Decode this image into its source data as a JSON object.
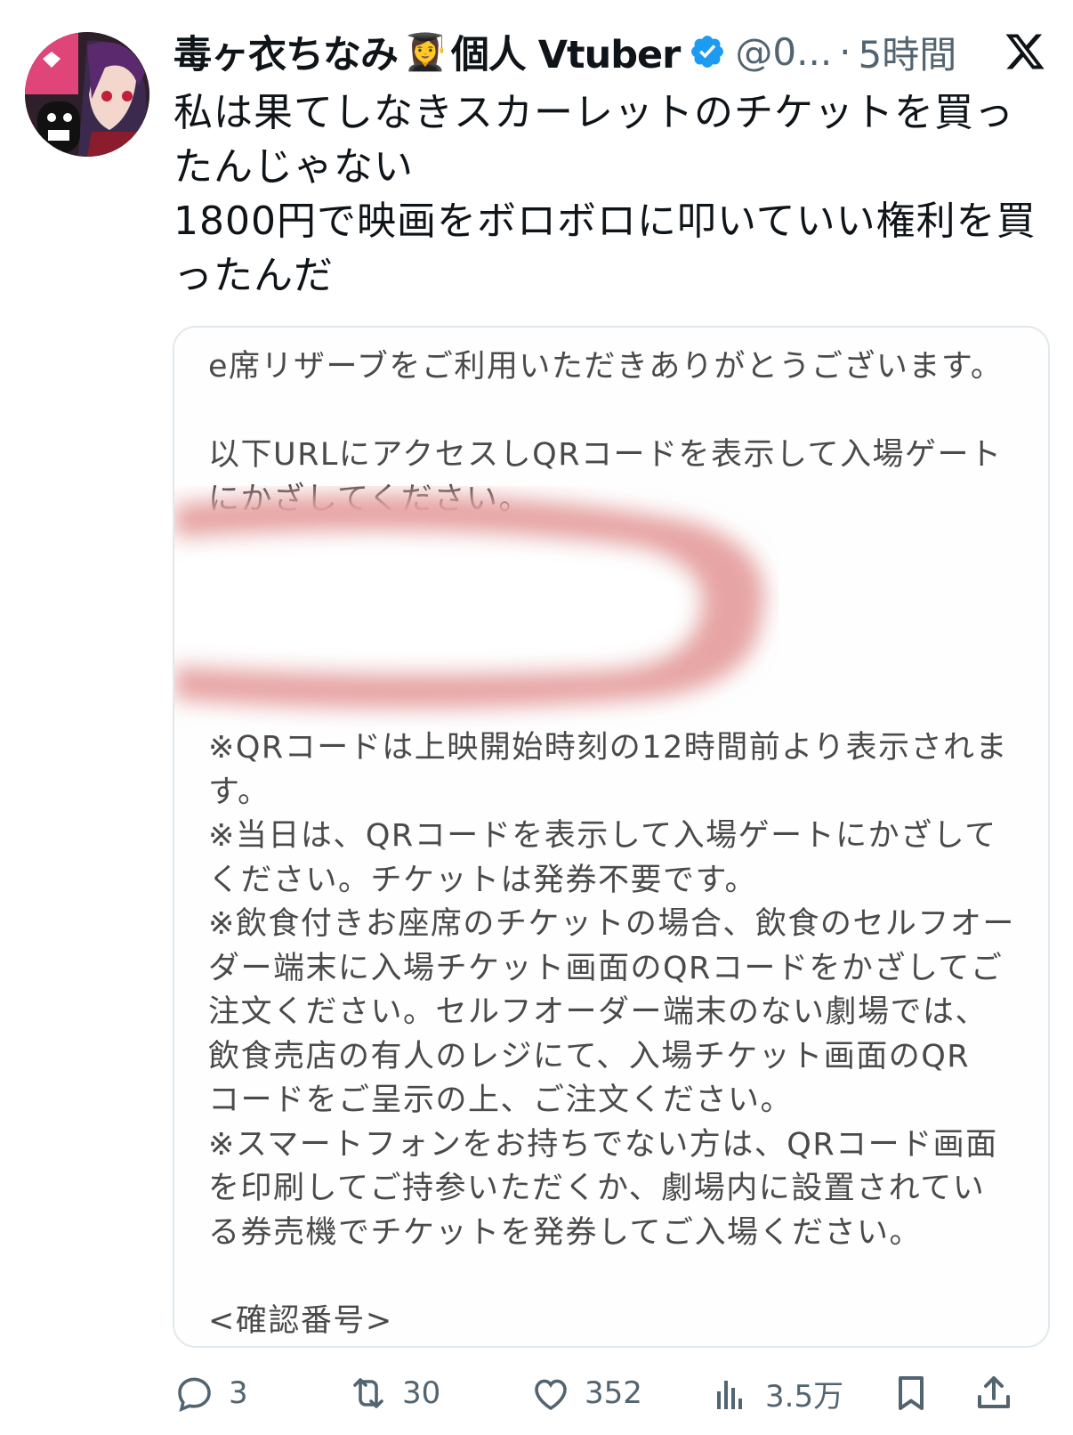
{
  "author": {
    "display_name": "毒ヶ衣ちなみ",
    "emoji": "👩‍🎓",
    "name_suffix": "個人 Vtuber",
    "handle": "@0...",
    "separator": "·",
    "time": "5時間"
  },
  "tweet": {
    "text": "私は果てしなきスカーレットのチケットを買っ\nたんじゃない\n1800円で映画をボロボロに叩いていい権利を買\nったんだ"
  },
  "media": {
    "text_top": "e席リザーブをご利用いただきありがとうございます。\n\n以下URLにアクセスしQRコードを表示して入場ゲート\nにかざしてください。",
    "text_bottom": "※QRコードは上映開始時刻の12時間前より表示されま\nす。\n※当日は、QRコードを表示して入場ゲートにかざして\nください。チケットは発券不要です。\n※飲食付きお座席のチケットの場合、飲食のセルフオー\nダー端末に入場チケット画面のQRコードをかざしてご\n注文ください。セルフオーダー端末のない劇場では、\n飲食売店の有人のレジにて、入場チケット画面のQR\nコードをご呈示の上、ご注文ください。\n※スマートフォンをお持ちでない方は、QRコード画面\nを印刷してご持参いただくか、劇場内に設置されてい\nる券売機でチケットを発券してご入場ください。\n\n<確認番号>"
  },
  "actions": {
    "reply_count": "3",
    "repost_count": "30",
    "like_count": "352",
    "view_count": "3.5万"
  },
  "icons": [
    "avatar",
    "verified-badge-icon",
    "x-logo-icon",
    "reply-icon",
    "repost-icon",
    "like-icon",
    "views-icon",
    "bookmark-icon",
    "share-icon"
  ],
  "colors": {
    "verified": "#1d9bf0",
    "secondary_text": "#536471",
    "redaction": "#e8a0a0"
  }
}
